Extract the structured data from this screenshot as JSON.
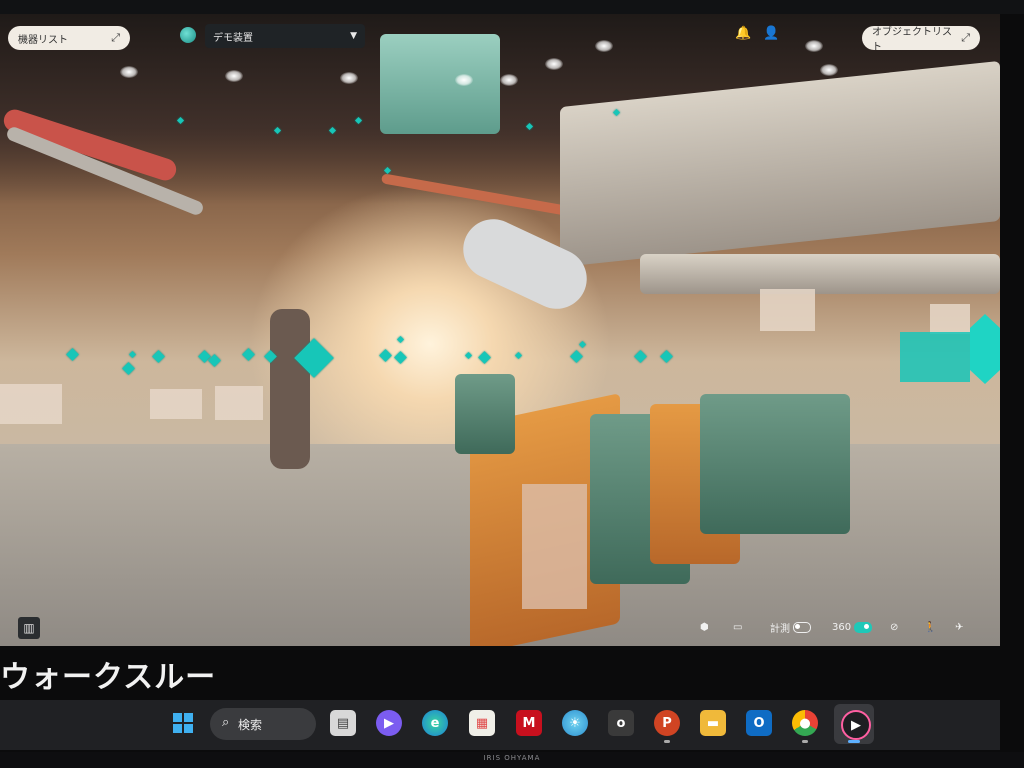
{
  "viewer": {
    "equipment_list_label": "機器リスト",
    "object_list_label": "オブジェクトリスト",
    "project_select_value": "デモ装置",
    "toolbar": {
      "measure_label": "計測",
      "view360_label": "360"
    }
  },
  "caption": "ウォークスルー",
  "taskbar": {
    "search_label": "検索"
  },
  "monitor_brand": "IRIS OHYAMA",
  "colors": {
    "marker": "#17c6b8",
    "pill_bg": "#f1ece4",
    "taskbar_bg": "#202124"
  }
}
